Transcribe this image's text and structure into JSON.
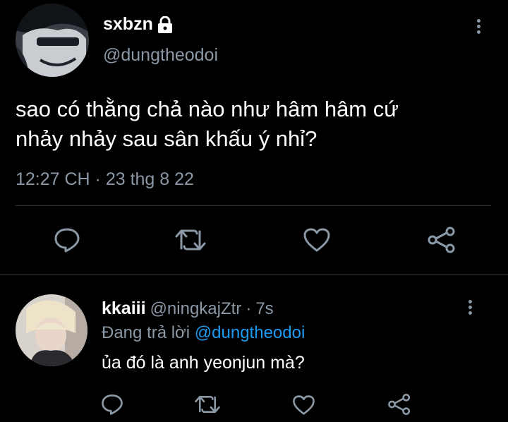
{
  "tweet": {
    "display_name": "sxbzn",
    "handle": "@dungtheodoi",
    "text_line1": "sao có thằng chả nào như hâm hâm cứ",
    "text_line2": "nhảy nhảy sau sân khấu ý nhỉ?",
    "timestamp": "12:27 CH · 23 thg 8 22",
    "lock_icon": "lock-icon",
    "actions": [
      "reply-icon",
      "retweet-icon",
      "like-icon",
      "share-icon"
    ]
  },
  "reply": {
    "display_name": "kkaiii",
    "handle": "@ningkajZtr",
    "separator": "·",
    "age": "7s",
    "replying_prefix": "Đang trả lời",
    "replying_to": "@dungtheodoi",
    "text": "ủa đó là anh yeonjun mà?",
    "actions": [
      "reply-icon",
      "retweet-icon",
      "like-icon",
      "share-icon"
    ]
  },
  "colors": {
    "background": "#000000",
    "muted": "#8b98a5",
    "link": "#1d9bf0",
    "divider": "#2f3336"
  }
}
